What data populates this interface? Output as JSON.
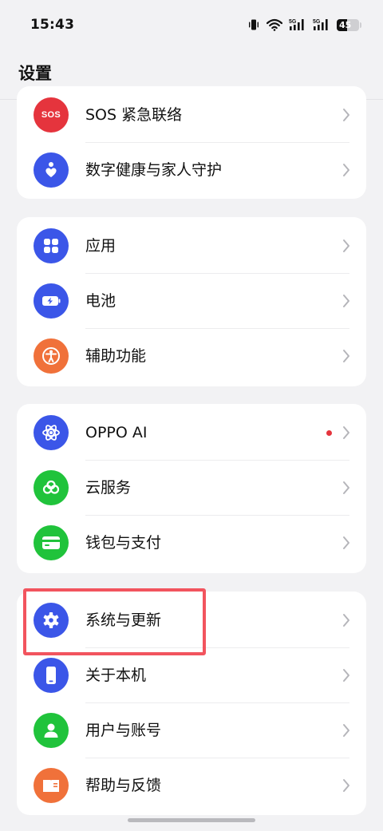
{
  "status_bar": {
    "time": "15:43",
    "network_5g_1": "5G",
    "network_5g_2": "5G",
    "battery_level": "45",
    "battery_fraction": 0.45
  },
  "header": {
    "title": "设置"
  },
  "colors": {
    "accent_blue": "#3b56e8",
    "sos_red": "#e5343d",
    "orange": "#f0713a",
    "green": "#20c33b",
    "highlight": "#f2545e",
    "background": "#f2f2f4",
    "card": "#ffffff"
  },
  "groups": [
    {
      "items": [
        {
          "label": "SOS 紧急联络",
          "icon": "sos-icon",
          "icon_text": "SOS",
          "color": "#e5343d"
        },
        {
          "label": "数字健康与家人守护",
          "icon": "heart-hand-icon",
          "color": "#3b56e8"
        }
      ]
    },
    {
      "items": [
        {
          "label": "应用",
          "icon": "apps-grid-icon",
          "color": "#3b56e8"
        },
        {
          "label": "电池",
          "icon": "battery-charging-icon",
          "color": "#3b56e8"
        },
        {
          "label": "辅助功能",
          "icon": "accessibility-icon",
          "color": "#f0713a"
        }
      ]
    },
    {
      "items": [
        {
          "label": "OPPO AI",
          "icon": "ai-sparkle-icon",
          "color": "#3b56e8",
          "has_badge": true
        },
        {
          "label": "云服务",
          "icon": "cloud-service-icon",
          "color": "#20c33b"
        },
        {
          "label": "钱包与支付",
          "icon": "wallet-card-icon",
          "color": "#20c33b"
        }
      ]
    },
    {
      "items": [
        {
          "label": "系统与更新",
          "icon": "gear-icon",
          "color": "#3b56e8",
          "highlighted": true
        },
        {
          "label": "关于本机",
          "icon": "phone-icon",
          "color": "#3b56e8"
        },
        {
          "label": "用户与账号",
          "icon": "user-icon",
          "color": "#20c33b"
        },
        {
          "label": "帮助与反馈",
          "icon": "help-book-icon",
          "color": "#f0713a"
        }
      ]
    }
  ]
}
